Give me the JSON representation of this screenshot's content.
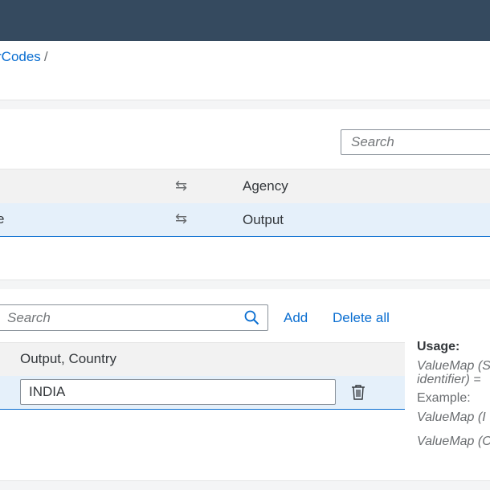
{
  "breadcrumb": {
    "partial_link": "rCodes",
    "separator": "/"
  },
  "top_section": {
    "search": {
      "placeholder": "Search"
    },
    "left_truncated": "e",
    "header_row": {
      "swap_icon": "swap-arrows-icon",
      "label": "Agency"
    },
    "selected_row": {
      "swap_icon": "swap-arrows-icon",
      "label": "Output"
    }
  },
  "value_mappings": {
    "search": {
      "placeholder": "Search"
    },
    "add_label": "Add",
    "delete_all_label": "Delete all",
    "column_header": "Output, Country",
    "rows": [
      {
        "value": "INDIA"
      }
    ]
  },
  "usage": {
    "title": "Usage:",
    "line1": "ValueMap (S",
    "line2": "identifier) =",
    "example_label": "Example:",
    "example1": "ValueMap (I",
    "example2": "ValueMap (C"
  },
  "colors": {
    "shell": "#354a5f",
    "accent": "#0a6ed1",
    "selected_row": "#e5f0fa"
  }
}
